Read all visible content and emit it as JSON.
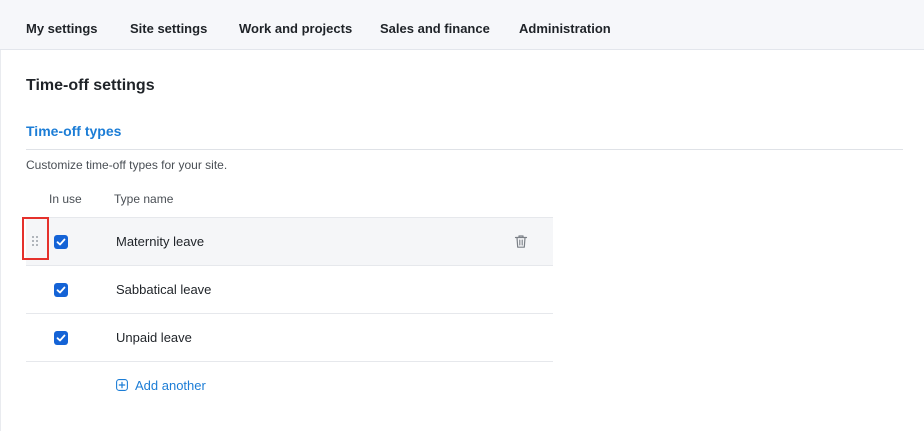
{
  "topnav": {
    "items": [
      {
        "label": "My settings"
      },
      {
        "label": "Site settings"
      },
      {
        "label": "Work and projects"
      },
      {
        "label": "Sales and finance"
      },
      {
        "label": "Administration"
      }
    ]
  },
  "page": {
    "title": "Time-off settings",
    "section_title": "Time-off types",
    "description": "Customize time-off types for your site."
  },
  "table": {
    "columns": {
      "in_use": "In use",
      "type_name": "Type name"
    },
    "rows": [
      {
        "name": "Maternity leave",
        "in_use": true
      },
      {
        "name": "Sabbatical leave",
        "in_use": true
      },
      {
        "name": "Unpaid leave",
        "in_use": true
      }
    ],
    "add_label": "Add another"
  },
  "colors": {
    "accent": "#1c7dd6",
    "checkbox": "#1463d6",
    "highlight": "#e5312c"
  }
}
